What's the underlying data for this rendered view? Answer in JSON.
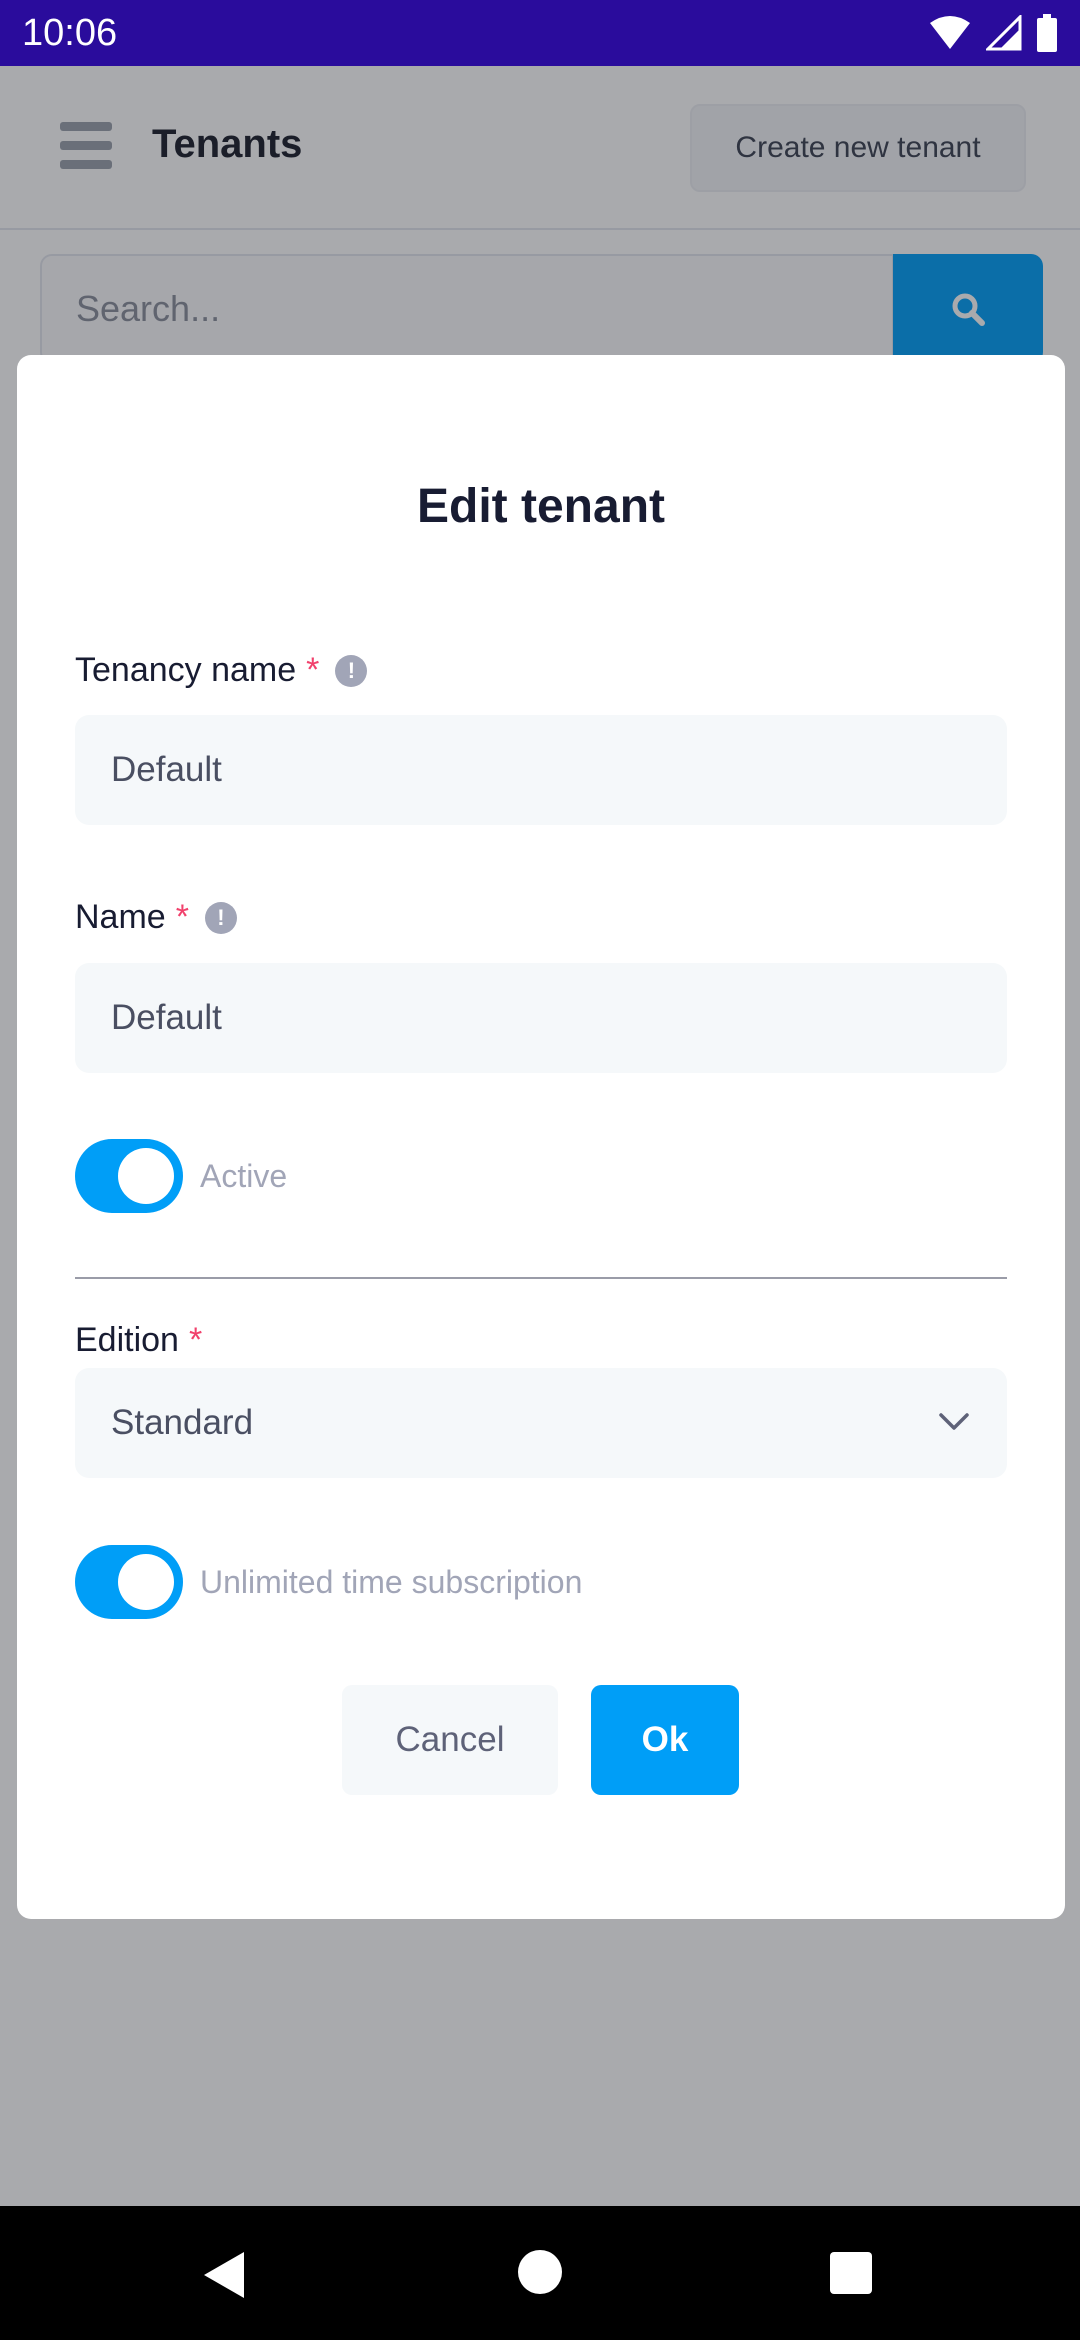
{
  "status_bar": {
    "time": "10:06"
  },
  "header": {
    "title": "Tenants",
    "create_button": "Create new tenant"
  },
  "search": {
    "placeholder": "Search..."
  },
  "modal": {
    "title": "Edit tenant",
    "tenancy_name": {
      "label": "Tenancy name",
      "required": "*",
      "value": "Default"
    },
    "name": {
      "label": "Name",
      "required": "*",
      "value": "Default"
    },
    "active_toggle": {
      "label": "Active",
      "checked": true
    },
    "edition": {
      "label": "Edition",
      "required": "*",
      "selected": "Standard"
    },
    "unlimited_toggle": {
      "label": "Unlimited time subscription",
      "checked": true
    },
    "cancel_button": "Cancel",
    "ok_button": "Ok"
  },
  "colors": {
    "primary": "#009ef7",
    "required": "#f1416c",
    "status_bar": "#2a0c9c"
  },
  "icons": {
    "info": "!",
    "search": "search-icon",
    "chevron": "chevron-down-icon"
  }
}
